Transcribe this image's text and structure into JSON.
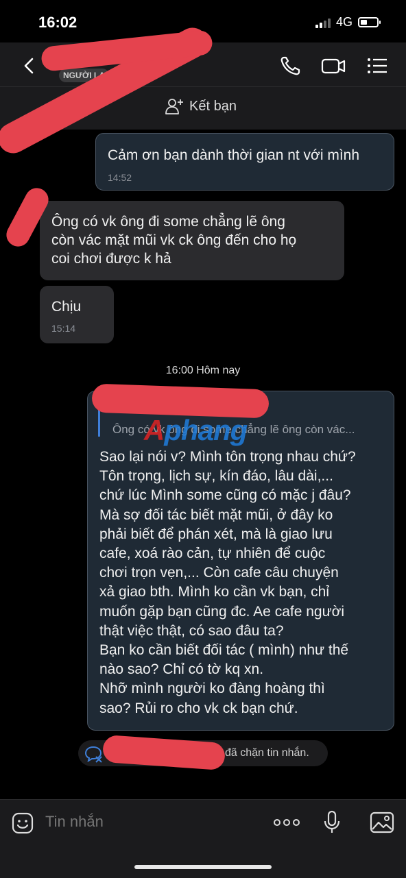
{
  "status": {
    "time": "16:02",
    "network": "4G"
  },
  "header": {
    "badge": "NGƯỜI LẠ",
    "add_friend_label": "Kết bạn"
  },
  "messages": [
    {
      "dir": "out",
      "text": "Cảm ơn bạn dành thời gian nt với mình",
      "time": "14:52"
    },
    {
      "dir": "in",
      "lines": [
        "Ông có vk ông đi some chẳng lẽ ông",
        "còn vác mặt mũi vk ck ông đến cho họ",
        "coi chơi được k hả"
      ]
    },
    {
      "dir": "in",
      "text": "Chịu",
      "time": "15:14"
    }
  ],
  "day_separator": "16:00 Hôm nay",
  "reply": {
    "quoted_text": "Ông có vk ông đi some chẳng lẽ ông còn vác...",
    "lines": [
      "Sao lại nói v? Mình tôn trọng nhau chứ?",
      "Tôn trọng, lịch sự, kín đáo, lâu dài,...",
      "chứ lúc Mình some cũng có mặc j đâu?",
      "Mà sợ đối tác biết mặt mũi, ở đây ko",
      "phải biết để phán xét, mà là giao lưu",
      "cafe, xoá rào cản, tự nhiên để cuộc",
      "chơi trọn vẹn,... Còn cafe câu chuyện",
      "xả giao bth. Mình ko cần vk bạn, chỉ",
      "muốn gặp bạn cũng đc. Ae cafe người",
      "thật việc thật, có sao đâu ta?",
      "Bạn ko cần biết đối tác ( mình) như thế",
      "nào sao? Chỉ có tờ kq xn.",
      "Nhỡ mình người ko đàng hoàng thì",
      "sao? Rủi ro cho vk ck bạn chứ."
    ]
  },
  "watermark": {
    "a": "A",
    "rest": "phang"
  },
  "system_notice": "đã chặn tin nhắn.",
  "input": {
    "placeholder": "Tin nhắn"
  },
  "colors": {
    "redaction": "#e5434e",
    "accent": "#1f7ddc"
  }
}
